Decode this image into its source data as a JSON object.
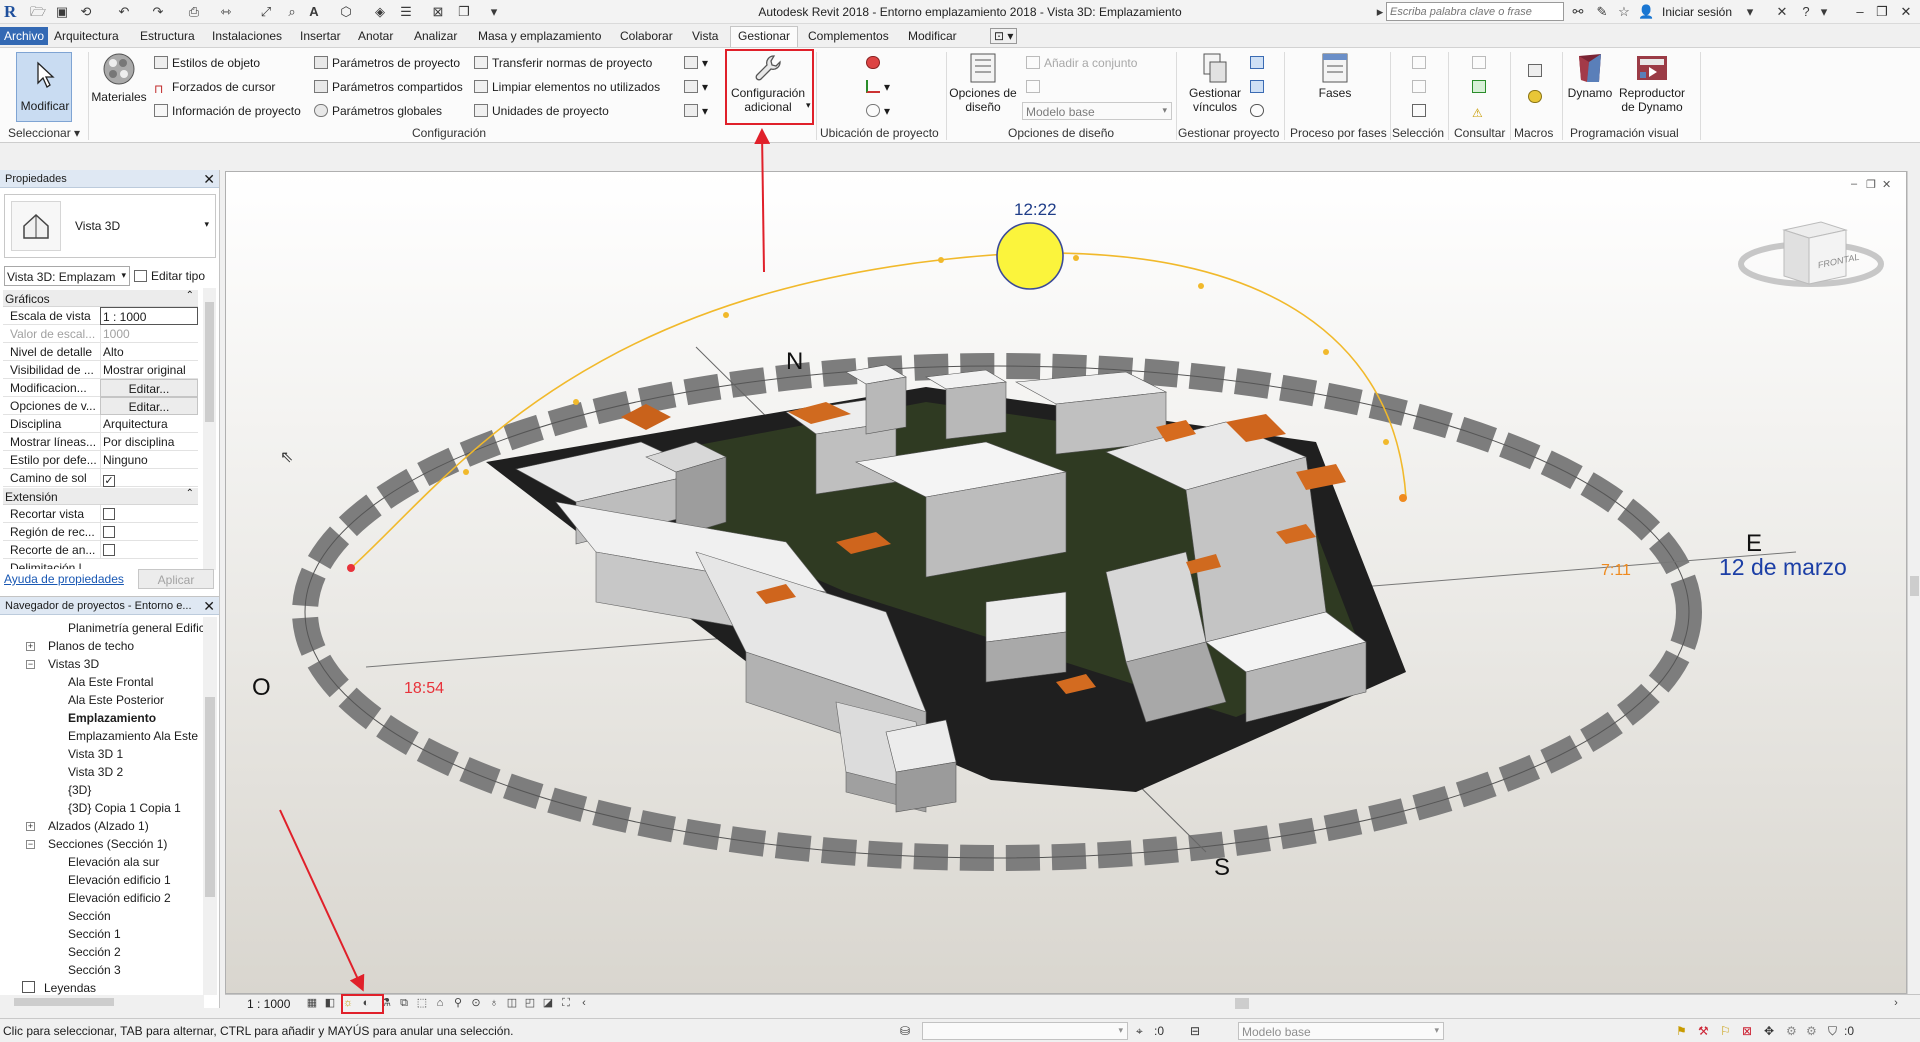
{
  "window": {
    "title": "Autodesk Revit 2018 -    Entorno emplazamiento 2018 - Vista 3D: Emplazamiento",
    "search_placeholder": "Escriba palabra clave o frase",
    "signin": "Iniciar sesión",
    "app_logo": "R"
  },
  "tabs": [
    {
      "label": "Archivo"
    },
    {
      "label": "Arquitectura"
    },
    {
      "label": "Estructura"
    },
    {
      "label": "Instalaciones"
    },
    {
      "label": "Insertar"
    },
    {
      "label": "Anotar"
    },
    {
      "label": "Analizar"
    },
    {
      "label": "Masa y emplazamiento"
    },
    {
      "label": "Colaborar"
    },
    {
      "label": "Vista"
    },
    {
      "label": "Gestionar"
    },
    {
      "label": "Complementos"
    },
    {
      "label": "Modificar"
    }
  ],
  "ribbon": {
    "modify": "Modificar",
    "select_panel": "Seleccionar",
    "materials": "Materiales",
    "object_styles": "Estilos de objeto",
    "snaps": "Forzados de cursor",
    "project_info": "Información de proyecto",
    "project_params": "Parámetros de proyecto",
    "shared_params": "Parámetros compartidos",
    "global_params": "Parámetros  globales",
    "transfer_standards": "Transferir normas de proyecto",
    "purge_unused": "Limpiar elementos no utilizados",
    "project_units": "Unidades de proyecto",
    "config_panel": "Configuración",
    "additional_settings_line1": "Configuración",
    "additional_settings_line2": "adicional",
    "location_panel": "Ubicación de proyecto",
    "design_options_line1": "Opciones de",
    "design_options_line2": "diseño",
    "add_to_set": "Añadir a conjunto",
    "main_model": "Modelo base",
    "design_options_panel": "Opciones de diseño",
    "manage_links_line1": "Gestionar",
    "manage_links_line2": "vínculos",
    "manage_project_panel": "Gestionar proyecto",
    "phases": "Fases",
    "phasing_panel": "Proceso por fases",
    "selection_panel": "Selección",
    "inquiry_panel": "Consultar",
    "macros_panel": "Macros",
    "dynamo": "Dynamo",
    "dynamo_player_line1": "Reproductor",
    "dynamo_player_line2": "de Dynamo",
    "visual_programming_panel": "Programación visual"
  },
  "properties": {
    "title": "Propiedades",
    "type_name": "Vista 3D",
    "instance_combo": "Vista 3D: Emplazam",
    "edit_type": "Editar tipo",
    "graphics_section": "Gráficos",
    "rows": [
      {
        "key": "Escala de vista",
        "value": "1 : 1000"
      },
      {
        "key": "Valor de escal...",
        "value": "1000"
      },
      {
        "key": "Nivel de detalle",
        "value": "Alto"
      },
      {
        "key": "Visibilidad de ...",
        "value": "Mostrar original"
      },
      {
        "key": "Modificacion...",
        "value": "Editar..."
      },
      {
        "key": "Opciones de v...",
        "value": "Editar..."
      },
      {
        "key": "Disciplina",
        "value": "Arquitectura"
      },
      {
        "key": "Mostrar líneas...",
        "value": "Por disciplina"
      },
      {
        "key": "Estilo por defe...",
        "value": "Ninguno"
      },
      {
        "key": "Camino de sol",
        "value": "✓"
      }
    ],
    "extents_section": "Extensión",
    "extent_rows": [
      {
        "key": "Recortar vista"
      },
      {
        "key": "Región de rec..."
      },
      {
        "key": "Recorte de an..."
      },
      {
        "key": "Delimitación l..."
      }
    ],
    "help_link": "Ayuda de propiedades",
    "apply": "Aplicar"
  },
  "browser": {
    "title": "Navegador de proyectos - Entorno e...",
    "items": [
      {
        "label": "Planimetría general Edific"
      },
      {
        "label": "Planos de techo"
      },
      {
        "label": "Vistas 3D"
      },
      {
        "label": "Ala Este Frontal"
      },
      {
        "label": "Ala Este Posterior"
      },
      {
        "label": "Emplazamiento"
      },
      {
        "label": "Emplazamiento Ala Este"
      },
      {
        "label": "Vista 3D 1"
      },
      {
        "label": "Vista 3D 2"
      },
      {
        "label": "{3D}"
      },
      {
        "label": "{3D} Copia 1 Copia 1"
      },
      {
        "label": "Alzados (Alzado 1)"
      },
      {
        "label": "Secciones (Sección 1)"
      },
      {
        "label": "Elevación ala sur"
      },
      {
        "label": "Elevación edificio 1"
      },
      {
        "label": "Elevación edificio 2"
      },
      {
        "label": "Sección"
      },
      {
        "label": "Sección 1"
      },
      {
        "label": "Sección 2"
      },
      {
        "label": "Sección 3"
      },
      {
        "label": "Leyendas"
      }
    ]
  },
  "viewport": {
    "sun_time": "12:22",
    "sunrise_time": "7:11",
    "sunset_time": "18:54",
    "date": "12 de marzo",
    "north": "N",
    "south": "S",
    "east": "E",
    "west": "O",
    "viewcube_face": "FRONTAL",
    "colors": {
      "sun_fill": "#fbf43c",
      "sun_path": "#f1b92b",
      "sunrise": "#ef8a1e",
      "sunset": "#e8323a",
      "date": "#1c3fa6",
      "time": "#1f3d88",
      "annotation": "#e0202a"
    }
  },
  "viewbar": {
    "scale": "1 : 1000"
  },
  "statusbar": {
    "hint": "Clic para seleccionar, TAB para alternar, CTRL para añadir y MAYÚS para anular una selección.",
    "count": ":0",
    "main_model": "Modelo base",
    "filter_count": ":0"
  }
}
